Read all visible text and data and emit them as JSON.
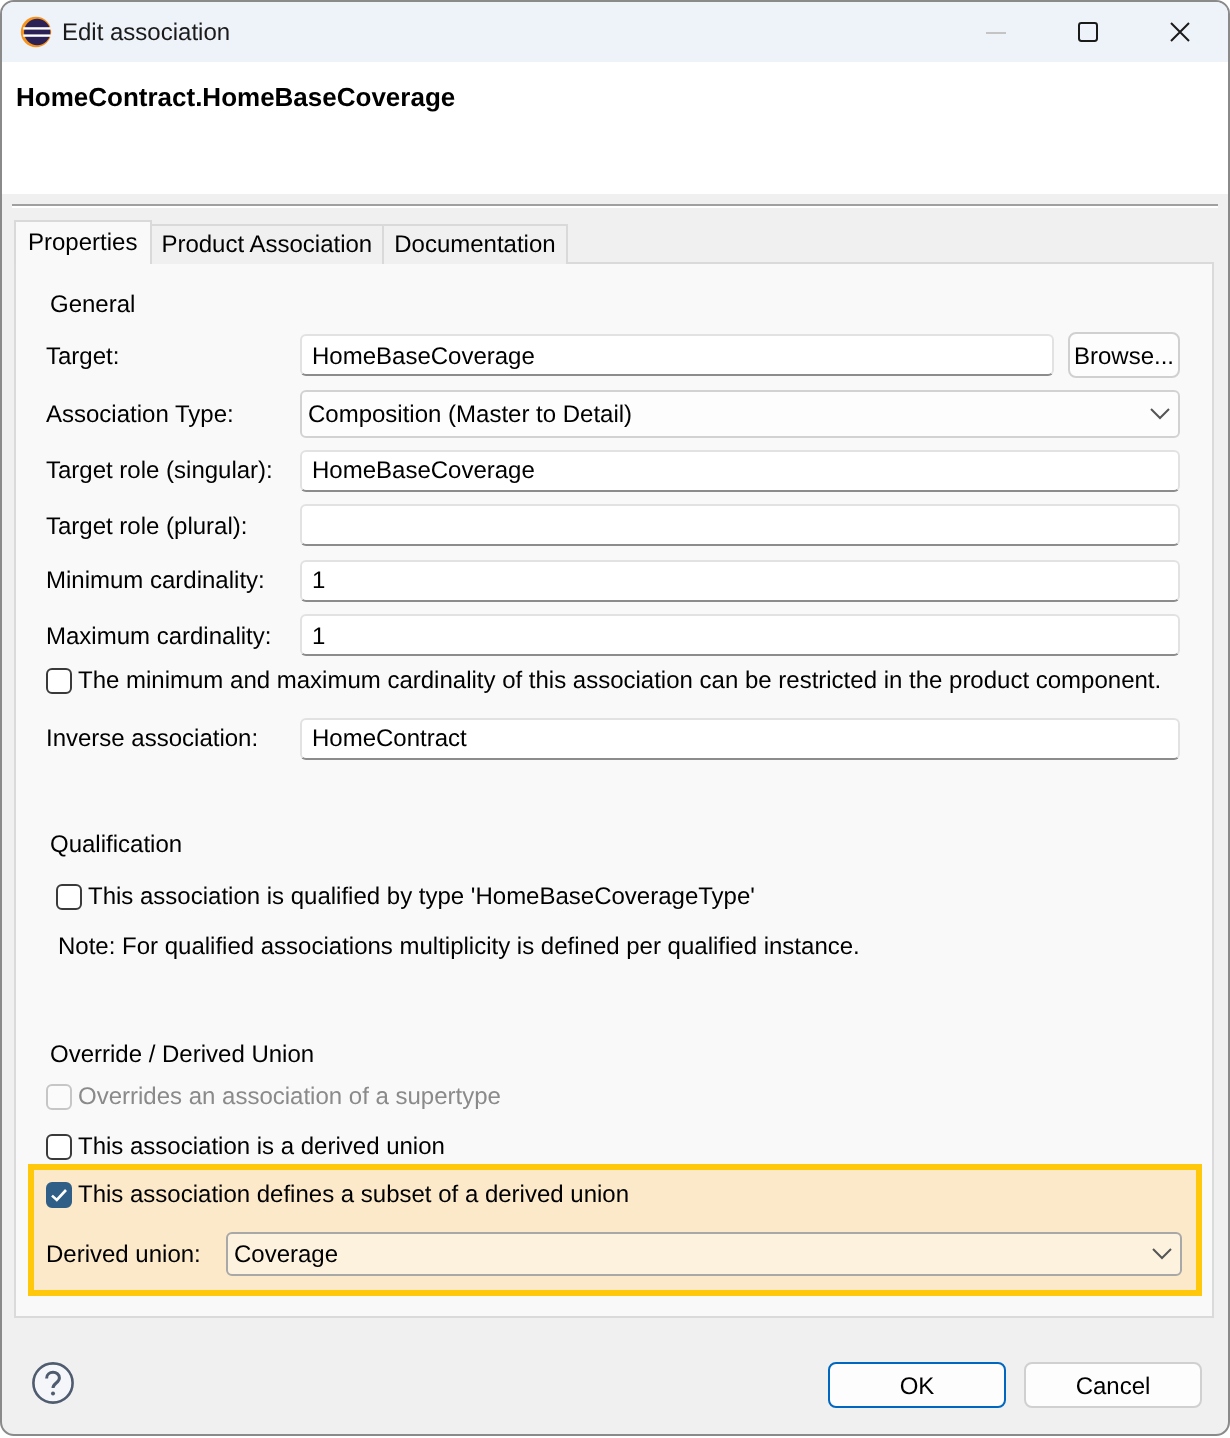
{
  "window": {
    "title": "Edit association"
  },
  "header": {
    "title": "HomeContract.HomeBaseCoverage"
  },
  "tabs": [
    {
      "label": "Properties",
      "selected": true
    },
    {
      "label": "Product Association",
      "selected": false
    },
    {
      "label": "Documentation",
      "selected": false
    }
  ],
  "general": {
    "heading": "General",
    "rows": [
      {
        "kind": "text",
        "label": "Target:",
        "value": "HomeBaseCoverage",
        "button": "Browse..."
      },
      {
        "kind": "combo",
        "label": "Association Type:",
        "value": "Composition (Master to Detail)"
      },
      {
        "kind": "text",
        "label": "Target role (singular):",
        "value": "HomeBaseCoverage"
      },
      {
        "kind": "text",
        "label": "Target role (plural):"
      },
      {
        "kind": "text",
        "label": "Minimum cardinality:",
        "value": "1"
      },
      {
        "kind": "text",
        "label": "Maximum cardinality:",
        "value": "1"
      },
      {
        "kind": "checkbox",
        "label": "The minimum and maximum cardinality of this association can be restricted in the product component.",
        "checked": false
      },
      {
        "kind": "text",
        "label": "Inverse association:",
        "value": "HomeContract"
      }
    ]
  },
  "qualification": {
    "heading": "Qualification",
    "checkbox": {
      "label": "This association is qualified by type 'HomeBaseCoverageType'",
      "checked": false
    },
    "note": "Note: For qualified associations multiplicity is defined per qualified instance."
  },
  "override": {
    "heading": "Override / Derived Union",
    "options": [
      {
        "label": "Overrides an association of a supertype",
        "checked": false,
        "disabled": true
      },
      {
        "label": "This association is a derived union",
        "checked": false,
        "disabled": false
      }
    ],
    "highlight": {
      "option": {
        "label": "This association defines a subset of a derived union",
        "checked": true,
        "disabled": false
      },
      "derived_union": {
        "label": "Derived union:",
        "value": "Coverage"
      }
    }
  },
  "buttons": [
    {
      "label": "OK",
      "default": true
    },
    {
      "label": "Cancel",
      "default": false
    }
  ]
}
